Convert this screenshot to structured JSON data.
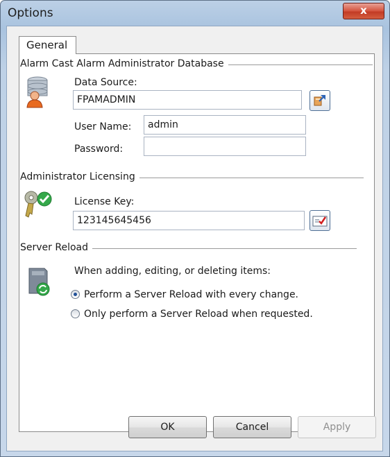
{
  "window": {
    "title": "Options",
    "close_glyph": "x"
  },
  "tabs": [
    {
      "label": "General"
    }
  ],
  "database_group": {
    "title": "Alarm Cast Alarm Administrator Database",
    "data_source_label": "Data Source:",
    "data_source_value": "FPAMADMIN",
    "username_label": "User Name:",
    "username_value": "admin",
    "password_label": "Password:",
    "password_value": "",
    "icon": "database-user-icon",
    "browse_icon": "data-source-browse-icon"
  },
  "licensing_group": {
    "title": "Administrator Licensing",
    "license_key_label": "License Key:",
    "license_key_value": "123145645456",
    "icon": "license-key-check-icon",
    "validate_icon": "license-validate-icon"
  },
  "reload_group": {
    "title": "Server Reload",
    "prompt": "When adding, editing, or deleting items:",
    "options": [
      {
        "label": "Perform a Server Reload with every change.",
        "selected": true
      },
      {
        "label": "Only perform a Server Reload when requested.",
        "selected": false
      }
    ],
    "icon": "server-reload-icon"
  },
  "buttons": {
    "ok": "OK",
    "cancel": "Cancel",
    "apply": "Apply"
  },
  "colors": {
    "titlebar": "#a9c3df",
    "close_button": "#c23b25",
    "radio_selected": "#1f4f97",
    "client_bg": "#f0f0f0"
  }
}
